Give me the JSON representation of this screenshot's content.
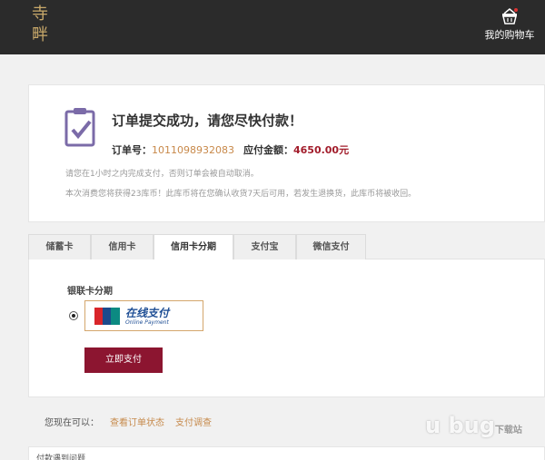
{
  "header": {
    "logo_text": "寺畔",
    "cart_label": "我的购物车"
  },
  "order": {
    "title": "订单提交成功，请您尽快付款！",
    "number_label": "订单号：",
    "number_value": "1011098932083",
    "amount_label": "应付金额：",
    "amount_value": "4650.00元",
    "note_1": "请您在1小时之内完成支付，否则订单会被自动取消。",
    "note_2": "本次消费您将获得23库币！此库币将在您确认收货7天后可用，若发生退换货，此库币将被收回。"
  },
  "tabs": [
    {
      "label": "储蓄卡"
    },
    {
      "label": "信用卡"
    },
    {
      "label": "信用卡分期"
    },
    {
      "label": "支付宝"
    },
    {
      "label": "微信支付"
    }
  ],
  "payment": {
    "section_label": "银联卡分期",
    "option_text": "在线支付",
    "option_sub": "Online Payment",
    "pay_button": "立即支付"
  },
  "footer": {
    "prompt": "您现在可以：",
    "link_1": "查看订单状态",
    "link_2": "支付调查",
    "bottom_title": "付款遇到问题"
  },
  "watermark": {
    "text": "u bug",
    "sub": "下载站"
  },
  "colors": {
    "topbar": "#2b2b2b",
    "accent_gold": "#c8894a",
    "amount_red": "#a21d2b",
    "pay_button": "#8c1530",
    "icon_purple": "#7b6ba8"
  }
}
